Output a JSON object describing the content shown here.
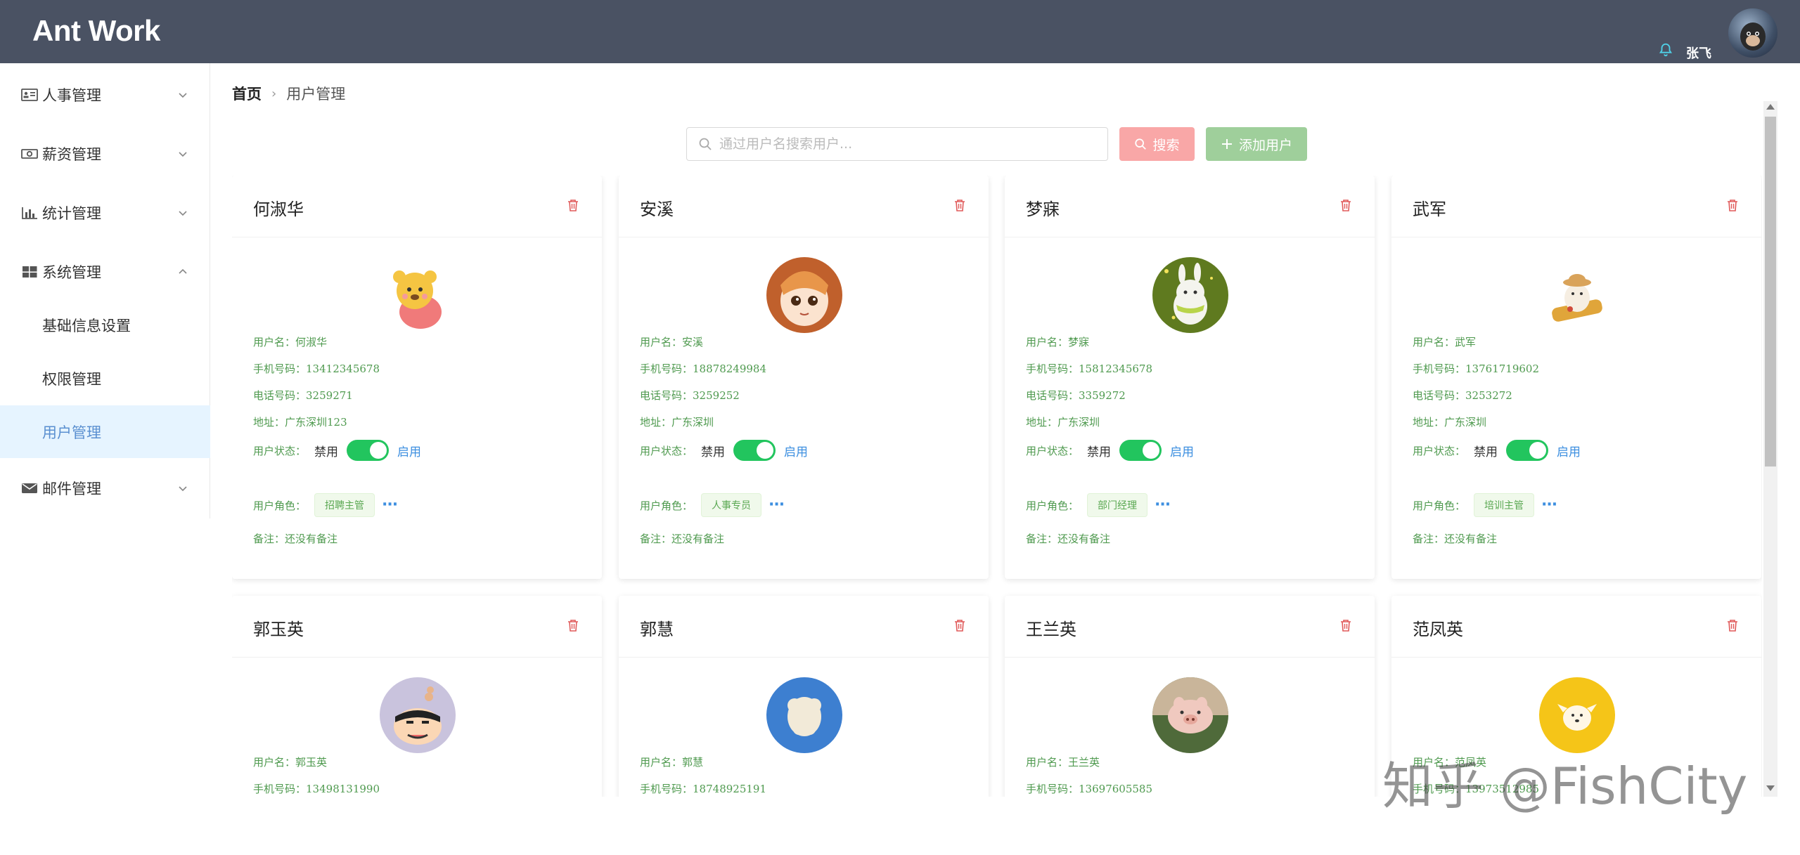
{
  "header": {
    "logo": "Ant Work",
    "user_name": "张飞"
  },
  "sidebar": {
    "items": [
      {
        "label": "人事管理",
        "icon": "id-card-icon",
        "expanded": false
      },
      {
        "label": "薪资管理",
        "icon": "money-icon",
        "expanded": false
      },
      {
        "label": "统计管理",
        "icon": "bar-chart-icon",
        "expanded": false
      },
      {
        "label": "系统管理",
        "icon": "windows-icon",
        "expanded": true,
        "children": [
          {
            "label": "基础信息设置"
          },
          {
            "label": "权限管理"
          },
          {
            "label": "用户管理",
            "active": true
          }
        ]
      },
      {
        "label": "邮件管理",
        "icon": "envelope-icon",
        "expanded": false
      }
    ]
  },
  "breadcrumb": {
    "home": "首页",
    "current": "用户管理"
  },
  "toolbar": {
    "search_placeholder": "通过用户名搜索用户...",
    "search_label": "搜索",
    "add_label": "添加用户"
  },
  "labels": {
    "username": "用户名：",
    "phone": "手机号码：",
    "telephone": "电话号码：",
    "address": "地址：",
    "status": "用户状态：",
    "disabled": "禁用",
    "enabled": "启用",
    "role": "用户角色：",
    "remark": "备注："
  },
  "cards": [
    {
      "name": "何淑华",
      "username": "何淑华",
      "phone": "13412345678",
      "telephone": "3259271",
      "address": "广东深圳123",
      "enabled": true,
      "role": "招聘主管",
      "remark": "还没有备注"
    },
    {
      "name": "安溪",
      "username": "安溪",
      "phone": "18878249984",
      "telephone": "3259252",
      "address": "广东深圳",
      "enabled": true,
      "role": "人事专员",
      "remark": "还没有备注"
    },
    {
      "name": "梦寐",
      "username": "梦寐",
      "phone": "15812345678",
      "telephone": "3359272",
      "address": "广东深圳",
      "enabled": true,
      "role": "部门经理",
      "remark": "还没有备注"
    },
    {
      "name": "武军",
      "username": "武军",
      "phone": "13761719602",
      "telephone": "3253272",
      "address": "广东深圳",
      "enabled": true,
      "role": "培训主管",
      "remark": "还没有备注"
    },
    {
      "name": "郭玉英",
      "username": "郭玉英",
      "phone": "13498131990"
    },
    {
      "name": "郭慧",
      "username": "郭慧",
      "phone": "18748925191"
    },
    {
      "name": "王兰英",
      "username": "王兰英",
      "phone": "13697605585"
    },
    {
      "name": "范凤英",
      "username": "范凤英",
      "phone": "13973512985"
    }
  ],
  "watermark": "知乎 @FishCity",
  "colors": {
    "header_bg": "#4a5263",
    "active_menu_bg": "#e6f4ff",
    "toggle_on": "#22c55e",
    "field_text": "#4f9a4f",
    "delete_icon": "#e05a5a"
  }
}
